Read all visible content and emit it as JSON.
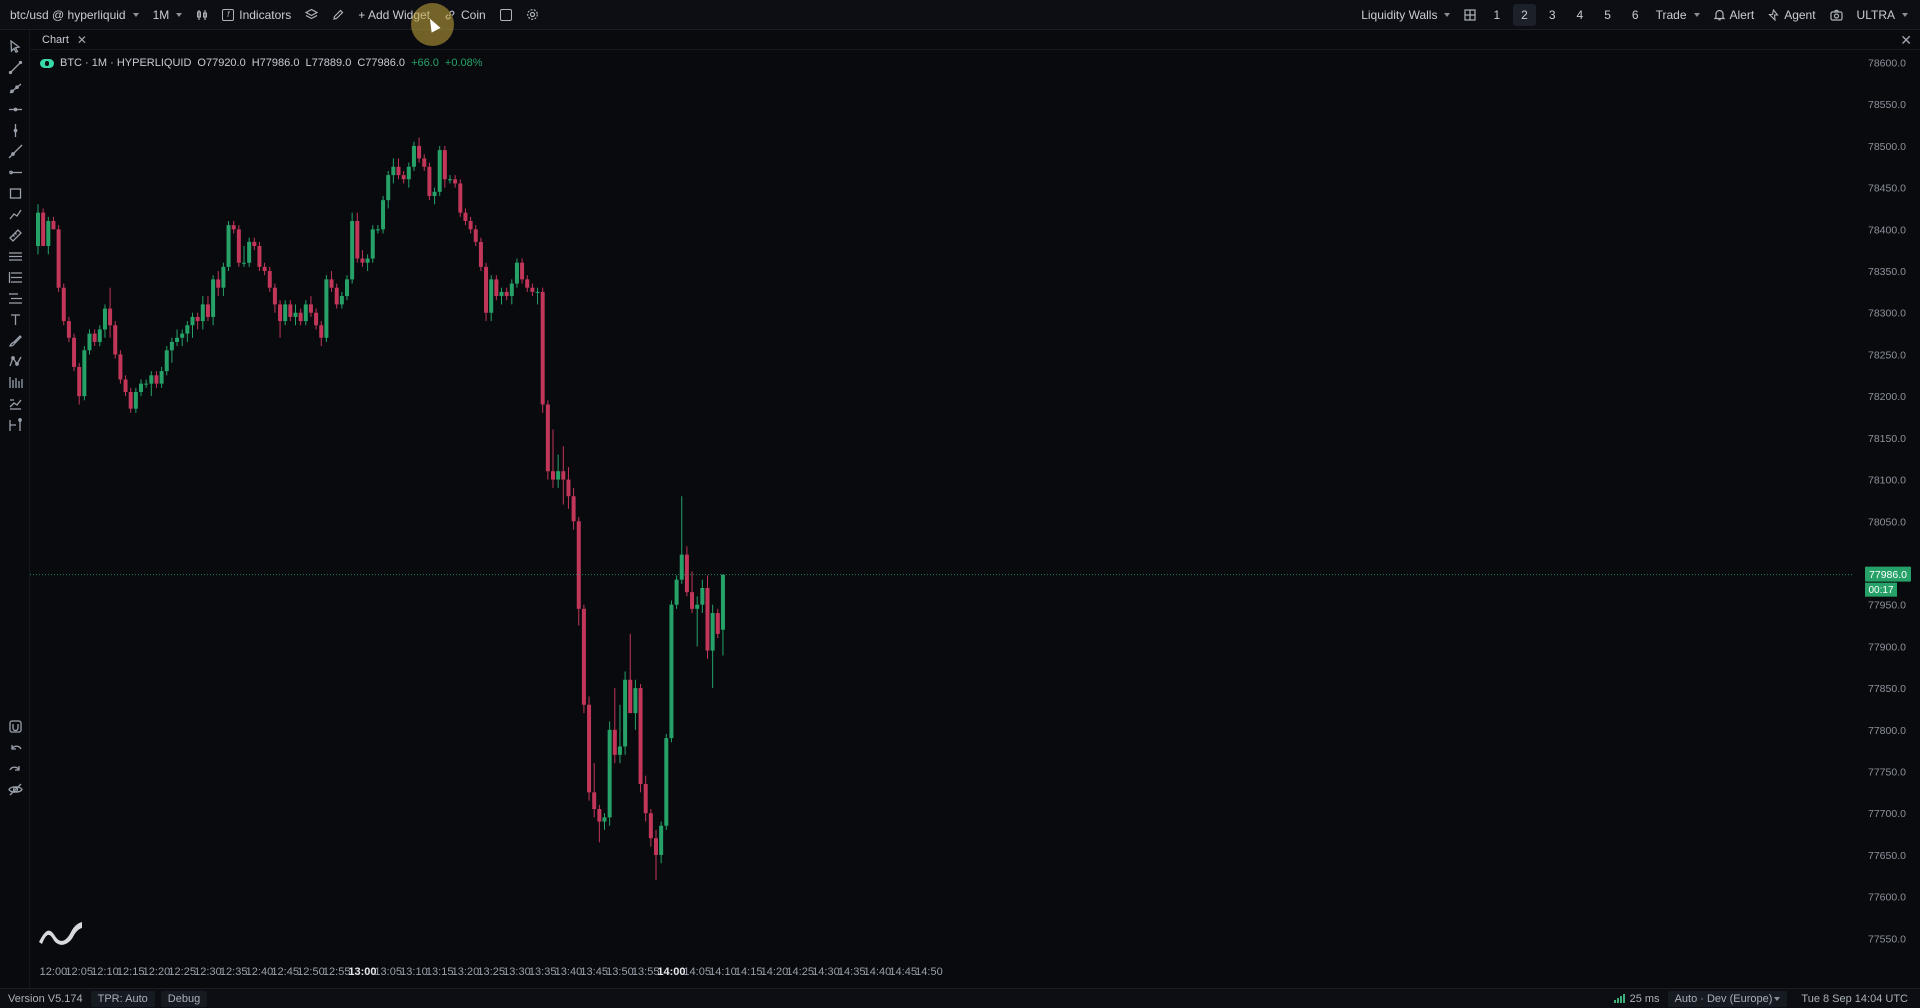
{
  "toolbar": {
    "symbol": "btc/usd @ hyperliquid",
    "timeframe": "1M",
    "indicators": "Indicators",
    "add_widget": "+ Add Widget",
    "coin": "Coin",
    "liquidity_walls": "Liquidity Walls",
    "layouts": [
      "1",
      "2",
      "3",
      "4",
      "5",
      "6"
    ],
    "active_layout": "2",
    "trade": "Trade",
    "alert": "Alert",
    "agent": "Agent",
    "plan": "ULTRA"
  },
  "tab": {
    "label": "Chart"
  },
  "legend": {
    "title": "BTC · 1M · HYPERLIQUID",
    "open": "O77920.0",
    "high": "H77986.0",
    "low": "L77889.0",
    "close": "C77986.0",
    "change": "+66.0",
    "change_pct": "+0.08%"
  },
  "price_label": {
    "price": "77986.0",
    "countdown": "00:17"
  },
  "status": {
    "version": "Version V5.174",
    "tpr": "TPR: Auto",
    "debug": "Debug",
    "latency": "25 ms",
    "server": "Auto · Dev (Europe)",
    "datetime": "Tue 8 Sep  14:04  UTC"
  },
  "colors": {
    "up": "#26a269",
    "down": "#c2365a",
    "background": "#080a0e",
    "price_line": "#26a269"
  },
  "chart_data": {
    "type": "candlestick",
    "price_ticks": [
      "78600.0",
      "78550.0",
      "78500.0",
      "78450.0",
      "78400.0",
      "78350.0",
      "78300.0",
      "78250.0",
      "78200.0",
      "78150.0",
      "78100.0",
      "78050.0",
      "78000.0",
      "77950.0",
      "77900.0",
      "77850.0",
      "77800.0",
      "77750.0",
      "77700.0",
      "77650.0",
      "77600.0",
      "77550.0"
    ],
    "ylim": [
      77530,
      78615
    ],
    "time_ticks": [
      "12:00",
      "12:05",
      "12:10",
      "12:15",
      "12:20",
      "12:25",
      "12:30",
      "12:35",
      "12:40",
      "12:45",
      "12:50",
      "12:55",
      "13:00",
      "13:05",
      "13:10",
      "13:15",
      "13:20",
      "13:25",
      "13:30",
      "13:35",
      "13:40",
      "13:45",
      "13:50",
      "13:55",
      "14:00",
      "14:05",
      "14:10",
      "14:15",
      "14:20",
      "14:25",
      "14:30",
      "14:35",
      "14:40",
      "14:45",
      "14:50"
    ],
    "bold_ticks": [
      "13:00",
      "14:00"
    ],
    "start_time": "11:57",
    "last_price": 77986.0,
    "candles": [
      {
        "o": 78380,
        "h": 78430,
        "l": 78370,
        "c": 78420
      },
      {
        "o": 78420,
        "h": 78425,
        "l": 78380,
        "c": 78380
      },
      {
        "o": 78380,
        "h": 78415,
        "l": 78370,
        "c": 78410
      },
      {
        "o": 78410,
        "h": 78415,
        "l": 78400,
        "c": 78400
      },
      {
        "o": 78400,
        "h": 78405,
        "l": 78325,
        "c": 78330
      },
      {
        "o": 78330,
        "h": 78335,
        "l": 78285,
        "c": 78290
      },
      {
        "o": 78290,
        "h": 78295,
        "l": 78265,
        "c": 78270
      },
      {
        "o": 78270,
        "h": 78275,
        "l": 78230,
        "c": 78235
      },
      {
        "o": 78235,
        "h": 78240,
        "l": 78190,
        "c": 78200
      },
      {
        "o": 78200,
        "h": 78260,
        "l": 78195,
        "c": 78255
      },
      {
        "o": 78255,
        "h": 78280,
        "l": 78250,
        "c": 78275
      },
      {
        "o": 78275,
        "h": 78280,
        "l": 78260,
        "c": 78265
      },
      {
        "o": 78265,
        "h": 78285,
        "l": 78260,
        "c": 78280
      },
      {
        "o": 78280,
        "h": 78310,
        "l": 78270,
        "c": 78305
      },
      {
        "o": 78305,
        "h": 78330,
        "l": 78270,
        "c": 78285
      },
      {
        "o": 78285,
        "h": 78290,
        "l": 78245,
        "c": 78250
      },
      {
        "o": 78250,
        "h": 78255,
        "l": 78215,
        "c": 78220
      },
      {
        "o": 78220,
        "h": 78225,
        "l": 78200,
        "c": 78205
      },
      {
        "o": 78205,
        "h": 78210,
        "l": 78180,
        "c": 78185
      },
      {
        "o": 78185,
        "h": 78210,
        "l": 78180,
        "c": 78205
      },
      {
        "o": 78205,
        "h": 78220,
        "l": 78200,
        "c": 78215
      },
      {
        "o": 78215,
        "h": 78220,
        "l": 78210,
        "c": 78215
      },
      {
        "o": 78215,
        "h": 78230,
        "l": 78200,
        "c": 78225
      },
      {
        "o": 78225,
        "h": 78230,
        "l": 78210,
        "c": 78215
      },
      {
        "o": 78215,
        "h": 78235,
        "l": 78210,
        "c": 78230
      },
      {
        "o": 78230,
        "h": 78260,
        "l": 78225,
        "c": 78255
      },
      {
        "o": 78255,
        "h": 78270,
        "l": 78240,
        "c": 78265
      },
      {
        "o": 78265,
        "h": 78280,
        "l": 78260,
        "c": 78270
      },
      {
        "o": 78270,
        "h": 78280,
        "l": 78260,
        "c": 78275
      },
      {
        "o": 78275,
        "h": 78290,
        "l": 78265,
        "c": 78285
      },
      {
        "o": 78285,
        "h": 78300,
        "l": 78270,
        "c": 78295
      },
      {
        "o": 78295,
        "h": 78300,
        "l": 78280,
        "c": 78290
      },
      {
        "o": 78290,
        "h": 78320,
        "l": 78280,
        "c": 78310
      },
      {
        "o": 78310,
        "h": 78320,
        "l": 78290,
        "c": 78295
      },
      {
        "o": 78295,
        "h": 78345,
        "l": 78285,
        "c": 78340
      },
      {
        "o": 78340,
        "h": 78350,
        "l": 78320,
        "c": 78330
      },
      {
        "o": 78330,
        "h": 78360,
        "l": 78320,
        "c": 78355
      },
      {
        "o": 78355,
        "h": 78410,
        "l": 78350,
        "c": 78405
      },
      {
        "o": 78405,
        "h": 78410,
        "l": 78395,
        "c": 78400
      },
      {
        "o": 78400,
        "h": 78405,
        "l": 78355,
        "c": 78360
      },
      {
        "o": 78360,
        "h": 78380,
        "l": 78355,
        "c": 78360
      },
      {
        "o": 78360,
        "h": 78390,
        "l": 78355,
        "c": 78385
      },
      {
        "o": 78385,
        "h": 78390,
        "l": 78375,
        "c": 78380
      },
      {
        "o": 78380,
        "h": 78385,
        "l": 78350,
        "c": 78355
      },
      {
        "o": 78355,
        "h": 78360,
        "l": 78345,
        "c": 78350
      },
      {
        "o": 78350,
        "h": 78355,
        "l": 78325,
        "c": 78330
      },
      {
        "o": 78330,
        "h": 78335,
        "l": 78300,
        "c": 78310
      },
      {
        "o": 78310,
        "h": 78315,
        "l": 78270,
        "c": 78290
      },
      {
        "o": 78290,
        "h": 78315,
        "l": 78285,
        "c": 78310
      },
      {
        "o": 78310,
        "h": 78315,
        "l": 78290,
        "c": 78295
      },
      {
        "o": 78295,
        "h": 78310,
        "l": 78285,
        "c": 78300
      },
      {
        "o": 78300,
        "h": 78305,
        "l": 78285,
        "c": 78290
      },
      {
        "o": 78290,
        "h": 78315,
        "l": 78285,
        "c": 78310
      },
      {
        "o": 78310,
        "h": 78320,
        "l": 78295,
        "c": 78300
      },
      {
        "o": 78300,
        "h": 78305,
        "l": 78280,
        "c": 78285
      },
      {
        "o": 78285,
        "h": 78290,
        "l": 78260,
        "c": 78270
      },
      {
        "o": 78270,
        "h": 78345,
        "l": 78265,
        "c": 78340
      },
      {
        "o": 78340,
        "h": 78350,
        "l": 78325,
        "c": 78330
      },
      {
        "o": 78330,
        "h": 78335,
        "l": 78305,
        "c": 78310
      },
      {
        "o": 78310,
        "h": 78325,
        "l": 78305,
        "c": 78320
      },
      {
        "o": 78320,
        "h": 78345,
        "l": 78315,
        "c": 78340
      },
      {
        "o": 78340,
        "h": 78420,
        "l": 78335,
        "c": 78410
      },
      {
        "o": 78410,
        "h": 78420,
        "l": 78360,
        "c": 78365
      },
      {
        "o": 78365,
        "h": 78375,
        "l": 78355,
        "c": 78360
      },
      {
        "o": 78360,
        "h": 78370,
        "l": 78350,
        "c": 78365
      },
      {
        "o": 78365,
        "h": 78405,
        "l": 78360,
        "c": 78400
      },
      {
        "o": 78400,
        "h": 78405,
        "l": 78395,
        "c": 78400
      },
      {
        "o": 78400,
        "h": 78440,
        "l": 78395,
        "c": 78435
      },
      {
        "o": 78435,
        "h": 78470,
        "l": 78425,
        "c": 78465
      },
      {
        "o": 78465,
        "h": 78485,
        "l": 78455,
        "c": 78475
      },
      {
        "o": 78475,
        "h": 78485,
        "l": 78460,
        "c": 78465
      },
      {
        "o": 78465,
        "h": 78470,
        "l": 78455,
        "c": 78460
      },
      {
        "o": 78460,
        "h": 78480,
        "l": 78450,
        "c": 78475
      },
      {
        "o": 78475,
        "h": 78505,
        "l": 78470,
        "c": 78500
      },
      {
        "o": 78500,
        "h": 78510,
        "l": 78480,
        "c": 78485
      },
      {
        "o": 78485,
        "h": 78490,
        "l": 78470,
        "c": 78475
      },
      {
        "o": 78475,
        "h": 78480,
        "l": 78435,
        "c": 78440
      },
      {
        "o": 78440,
        "h": 78450,
        "l": 78430,
        "c": 78445
      },
      {
        "o": 78445,
        "h": 78500,
        "l": 78440,
        "c": 78495
      },
      {
        "o": 78495,
        "h": 78500,
        "l": 78450,
        "c": 78460
      },
      {
        "o": 78460,
        "h": 78465,
        "l": 78455,
        "c": 78460
      },
      {
        "o": 78460,
        "h": 78465,
        "l": 78450,
        "c": 78455
      },
      {
        "o": 78455,
        "h": 78460,
        "l": 78415,
        "c": 78420
      },
      {
        "o": 78420,
        "h": 78425,
        "l": 78405,
        "c": 78410
      },
      {
        "o": 78410,
        "h": 78415,
        "l": 78395,
        "c": 78400
      },
      {
        "o": 78400,
        "h": 78405,
        "l": 78380,
        "c": 78385
      },
      {
        "o": 78385,
        "h": 78390,
        "l": 78350,
        "c": 78355
      },
      {
        "o": 78355,
        "h": 78360,
        "l": 78290,
        "c": 78300
      },
      {
        "o": 78300,
        "h": 78345,
        "l": 78290,
        "c": 78340
      },
      {
        "o": 78340,
        "h": 78345,
        "l": 78315,
        "c": 78320
      },
      {
        "o": 78320,
        "h": 78330,
        "l": 78310,
        "c": 78325
      },
      {
        "o": 78325,
        "h": 78330,
        "l": 78315,
        "c": 78320
      },
      {
        "o": 78320,
        "h": 78340,
        "l": 78310,
        "c": 78335
      },
      {
        "o": 78335,
        "h": 78365,
        "l": 78330,
        "c": 78360
      },
      {
        "o": 78360,
        "h": 78365,
        "l": 78335,
        "c": 78340
      },
      {
        "o": 78340,
        "h": 78345,
        "l": 78325,
        "c": 78330
      },
      {
        "o": 78330,
        "h": 78335,
        "l": 78320,
        "c": 78325
      },
      {
        "o": 78325,
        "h": 78330,
        "l": 78310,
        "c": 78325
      },
      {
        "o": 78325,
        "h": 78330,
        "l": 78180,
        "c": 78190
      },
      {
        "o": 78190,
        "h": 78195,
        "l": 78100,
        "c": 78110
      },
      {
        "o": 78110,
        "h": 78160,
        "l": 78090,
        "c": 78100
      },
      {
        "o": 78100,
        "h": 78130,
        "l": 78090,
        "c": 78110
      },
      {
        "o": 78110,
        "h": 78140,
        "l": 78070,
        "c": 78100
      },
      {
        "o": 78100,
        "h": 78115,
        "l": 78065,
        "c": 78080
      },
      {
        "o": 78080,
        "h": 78090,
        "l": 78040,
        "c": 78050
      },
      {
        "o": 78050,
        "h": 78055,
        "l": 77925,
        "c": 77945
      },
      {
        "o": 77945,
        "h": 77950,
        "l": 77820,
        "c": 77830
      },
      {
        "o": 77830,
        "h": 77840,
        "l": 77715,
        "c": 77725
      },
      {
        "o": 77725,
        "h": 77760,
        "l": 77695,
        "c": 77705
      },
      {
        "o": 77705,
        "h": 77710,
        "l": 77665,
        "c": 77690
      },
      {
        "o": 77690,
        "h": 77700,
        "l": 77680,
        "c": 77695
      },
      {
        "o": 77695,
        "h": 77810,
        "l": 77685,
        "c": 77800
      },
      {
        "o": 77800,
        "h": 77850,
        "l": 77760,
        "c": 77770
      },
      {
        "o": 77770,
        "h": 77830,
        "l": 77760,
        "c": 77780
      },
      {
        "o": 77780,
        "h": 77870,
        "l": 77770,
        "c": 77860
      },
      {
        "o": 77860,
        "h": 77915,
        "l": 77850,
        "c": 77820
      },
      {
        "o": 77820,
        "h": 77860,
        "l": 77800,
        "c": 77850
      },
      {
        "o": 77850,
        "h": 77855,
        "l": 77725,
        "c": 77735
      },
      {
        "o": 77735,
        "h": 77745,
        "l": 77690,
        "c": 77700
      },
      {
        "o": 77700,
        "h": 77705,
        "l": 77660,
        "c": 77670
      },
      {
        "o": 77670,
        "h": 77680,
        "l": 77620,
        "c": 77650
      },
      {
        "o": 77650,
        "h": 77690,
        "l": 77640,
        "c": 77685
      },
      {
        "o": 77685,
        "h": 77795,
        "l": 77680,
        "c": 77790
      },
      {
        "o": 77790,
        "h": 77955,
        "l": 77785,
        "c": 77950
      },
      {
        "o": 77950,
        "h": 77985,
        "l": 77945,
        "c": 77980
      },
      {
        "o": 77980,
        "h": 78080,
        "l": 77975,
        "c": 78010
      },
      {
        "o": 78010,
        "h": 78020,
        "l": 77960,
        "c": 77965
      },
      {
        "o": 77965,
        "h": 77990,
        "l": 77940,
        "c": 77945
      },
      {
        "o": 77945,
        "h": 77960,
        "l": 77900,
        "c": 77950
      },
      {
        "o": 77950,
        "h": 77980,
        "l": 77940,
        "c": 77970
      },
      {
        "o": 77970,
        "h": 77985,
        "l": 77885,
        "c": 77895
      },
      {
        "o": 77895,
        "h": 77950,
        "l": 77850,
        "c": 77940
      },
      {
        "o": 77940,
        "h": 77945,
        "l": 77910,
        "c": 77915
      },
      {
        "o": 77920,
        "h": 77986,
        "l": 77889,
        "c": 77986
      }
    ]
  }
}
